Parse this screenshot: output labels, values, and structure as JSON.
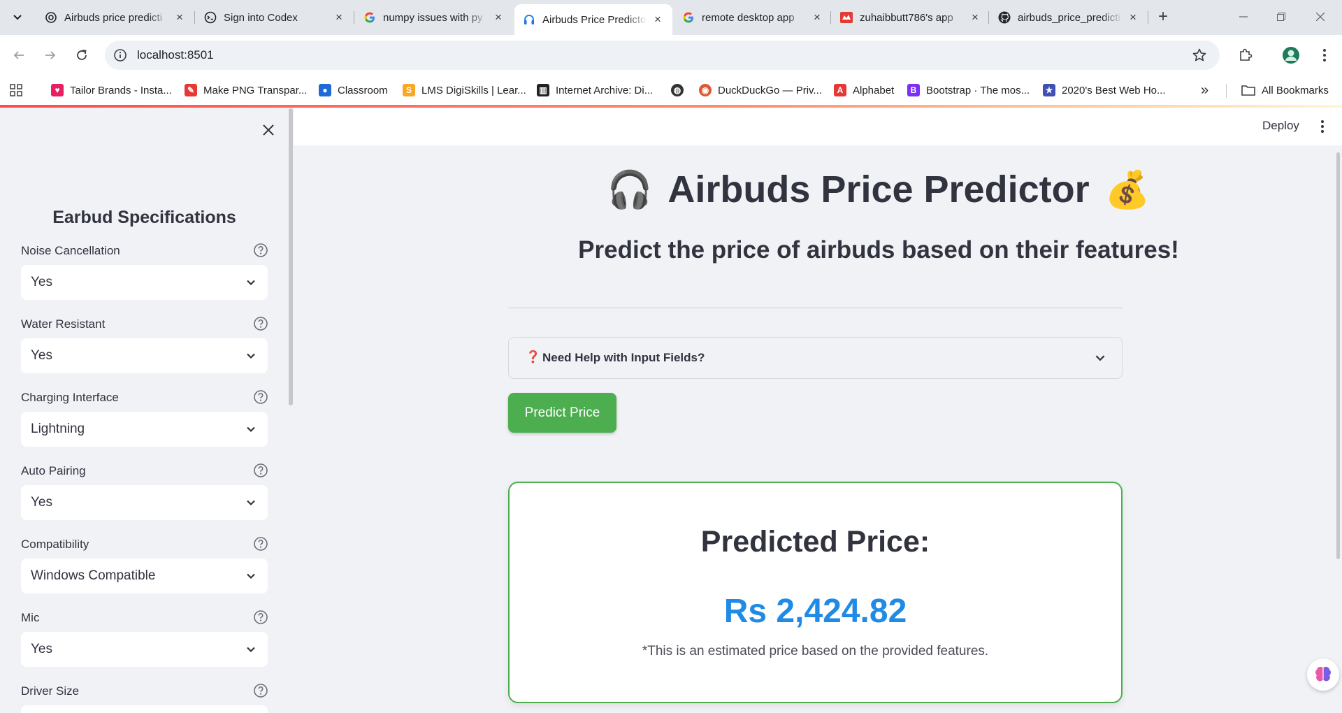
{
  "browser": {
    "tabs": [
      {
        "title": "Airbuds price predicti",
        "icon": "chatgpt-icon"
      },
      {
        "title": "Sign into Codex",
        "icon": "codex-icon"
      },
      {
        "title": "numpy issues with py",
        "icon": "google-icon"
      },
      {
        "title": "Airbuds Price Predicto",
        "icon": "headphones-icon"
      },
      {
        "title": "remote desktop app",
        "icon": "google-icon"
      },
      {
        "title": "zuhaibbutt786's app",
        "icon": "streamlit-icon"
      },
      {
        "title": "airbuds_price_predicti",
        "icon": "github-icon"
      }
    ],
    "active_tab": 3,
    "url": "localhost:8501",
    "bookmarks": [
      {
        "label": "Tailor Brands - Insta...",
        "color": "#e91e63"
      },
      {
        "label": "Make PNG Transpar...",
        "color": "#e53935"
      },
      {
        "label": "Classroom",
        "color": "#1e6ad8"
      },
      {
        "label": "LMS DigiSkills | Lear...",
        "color": "#f9a825"
      },
      {
        "label": "Internet Archive: Di...",
        "color": "#222222"
      },
      {
        "label": "",
        "color": "#333333"
      },
      {
        "label": "DuckDuckGo — Priv...",
        "color": "#de5833"
      },
      {
        "label": "Alphabet",
        "color": "#e53935"
      },
      {
        "label": "Bootstrap · The mos...",
        "color": "#7b2ff7"
      },
      {
        "label": "2020's Best Web Ho...",
        "color": "#3f51b5"
      }
    ],
    "all_bookmarks": "All Bookmarks",
    "bookmark_overflow": "»"
  },
  "header": {
    "deploy": "Deploy"
  },
  "sidebar": {
    "title": "Earbud Specifications",
    "fields": [
      {
        "label": "Noise Cancellation",
        "value": "Yes"
      },
      {
        "label": "Water Resistant",
        "value": "Yes"
      },
      {
        "label": "Charging Interface",
        "value": "Lightning"
      },
      {
        "label": "Auto Pairing",
        "value": "Yes"
      },
      {
        "label": "Compatibility",
        "value": "Windows Compatible"
      },
      {
        "label": "Mic",
        "value": "Yes"
      },
      {
        "label": "Driver Size",
        "value": ""
      }
    ]
  },
  "main": {
    "title": "Airbuds Price Predictor",
    "title_icon_left": "🎧",
    "title_icon_right": "💰",
    "subtitle": "Predict the price of airbuds based on their features!",
    "help_expander": "Need Help with Input Fields?",
    "help_mark": "❓",
    "predict_button": "Predict Price",
    "result": {
      "heading": "Predicted Price:",
      "price": "Rs 2,424.82",
      "note": "*This is an estimated price based on the provided features."
    }
  },
  "colors": {
    "accent_green": "#4cae4f",
    "price_blue": "#1f8be6",
    "text": "#31333f"
  }
}
